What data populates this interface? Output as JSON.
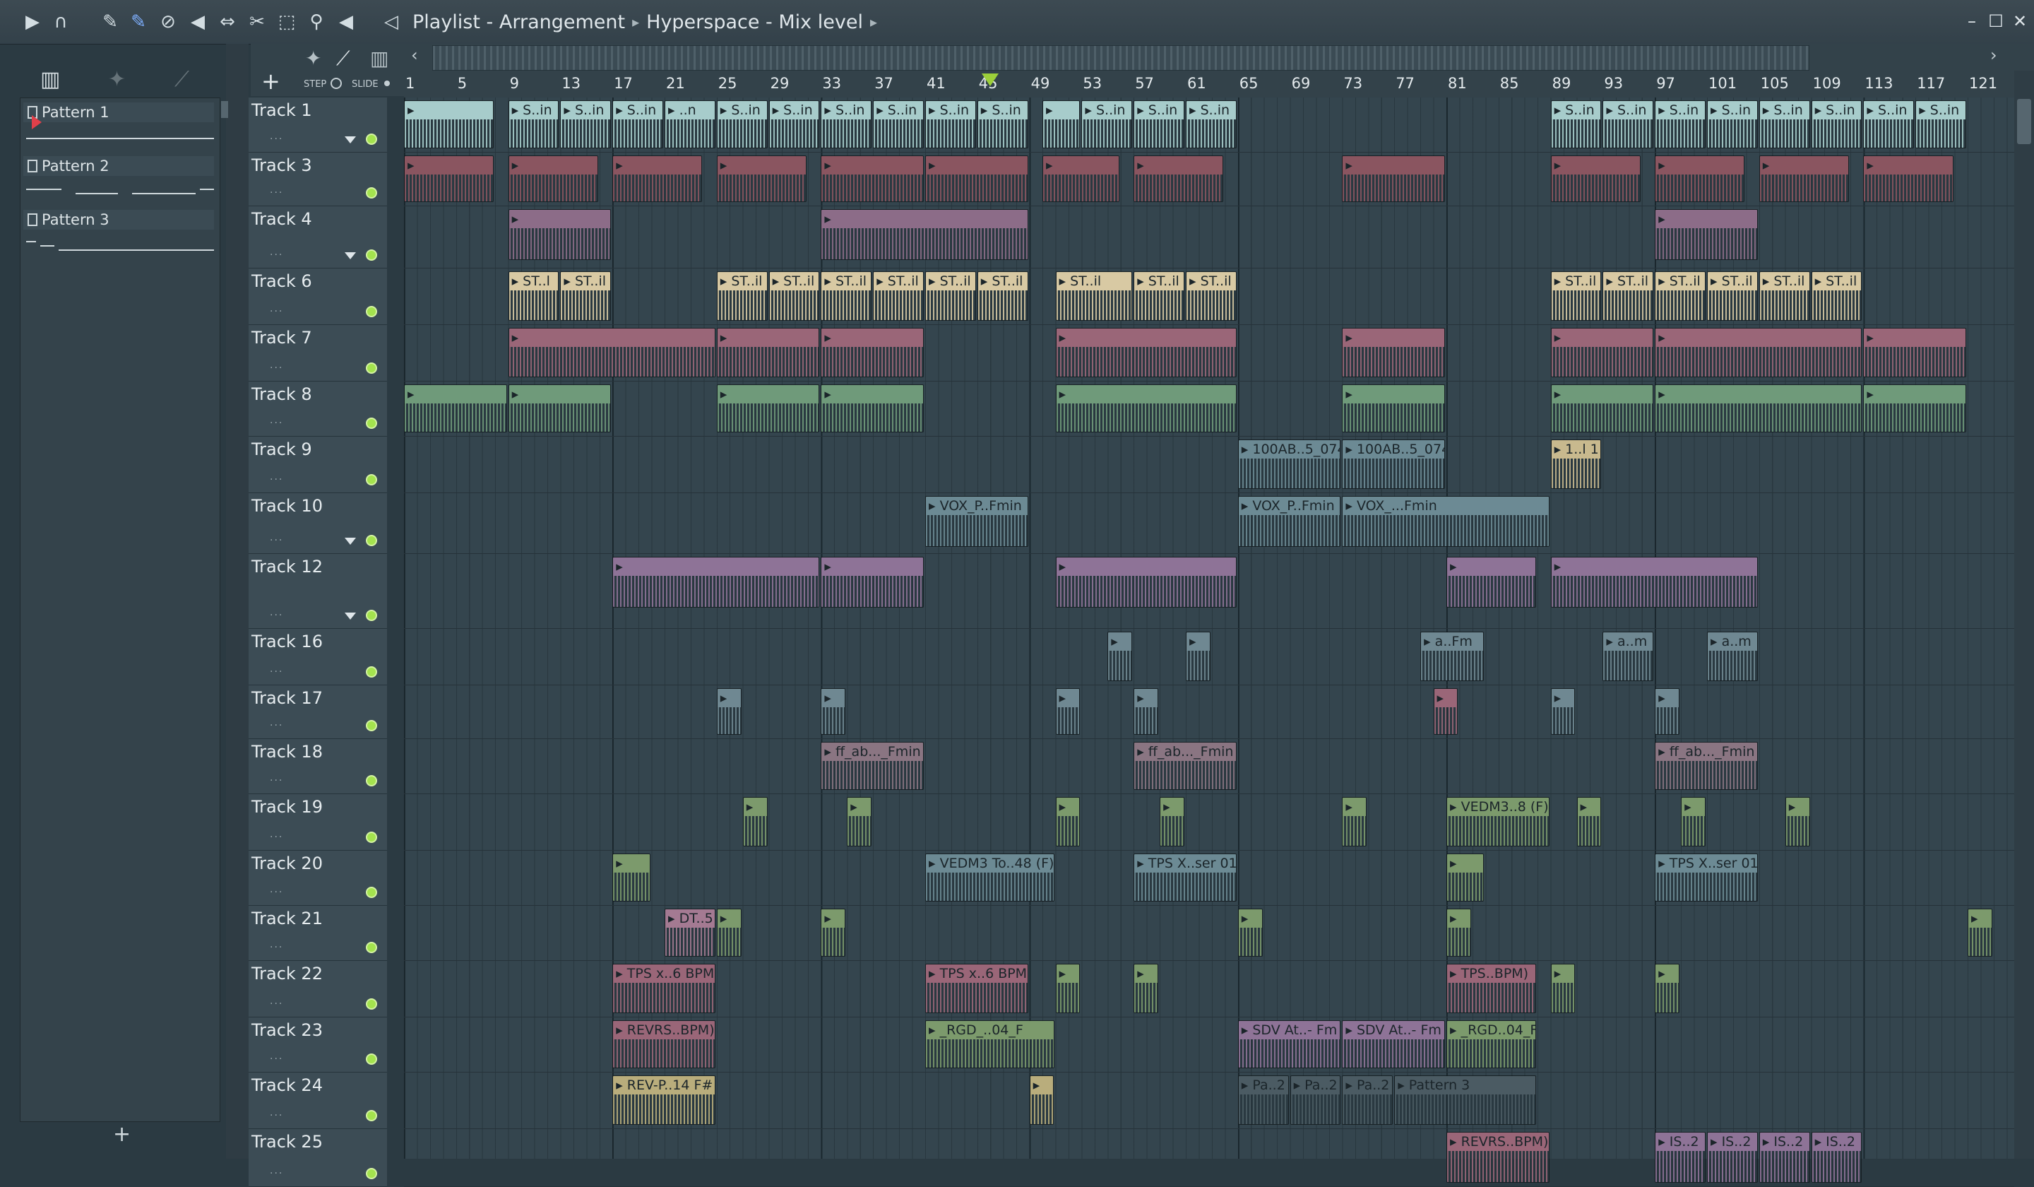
{
  "window": {
    "title": "Playlist - Arrangement",
    "breadcrumb_sep": "▸",
    "arrangement": "Hyperspace - Mix level",
    "controls": [
      "minimize",
      "maximize",
      "close"
    ]
  },
  "toolbar": {
    "icons": [
      "play-icon",
      "magnet-icon",
      "pencil-icon",
      "paint-brush-icon",
      "delete-icon",
      "mute-icon",
      "slip-icon",
      "slice-icon",
      "select-icon",
      "zoom-icon",
      "playback-icon",
      "speaker-icon"
    ]
  },
  "controls_row": {
    "add_track_symbol": "+",
    "step_label": "STEP",
    "slide_label": "SLIDE",
    "left_arrow": "‹",
    "right_arrow": "›"
  },
  "picker": {
    "add_symbol": "+",
    "patterns": [
      {
        "name": "Pattern 1"
      },
      {
        "name": "Pattern 2"
      },
      {
        "name": "Pattern 3"
      }
    ]
  },
  "ruler": {
    "bars": [
      "1",
      "5",
      "9",
      "13",
      "17",
      "21",
      "25",
      "29",
      "33",
      "37",
      "41",
      "45",
      "49",
      "53",
      "57",
      "61",
      "65",
      "69",
      "73",
      "77",
      "81",
      "85",
      "89",
      "93",
      "97",
      "101",
      "105",
      "109",
      "113",
      "117",
      "121"
    ],
    "playhead_bar": 46
  },
  "tracks": [
    {
      "name": "Track 1",
      "arrow": true
    },
    {
      "name": "Track 3",
      "arrow": false
    },
    {
      "name": "Track 4",
      "arrow": true
    },
    {
      "name": "Track 6",
      "arrow": false
    },
    {
      "name": "Track 7",
      "arrow": false
    },
    {
      "name": "Track 8",
      "arrow": false
    },
    {
      "name": "Track 9",
      "arrow": false
    },
    {
      "name": "Track 10",
      "arrow": true
    },
    {
      "name": "Track 12",
      "arrow": true
    },
    {
      "name": "Track 16",
      "arrow": false
    },
    {
      "name": "Track 17",
      "arrow": false
    },
    {
      "name": "Track 18",
      "arrow": false
    },
    {
      "name": "Track 19",
      "arrow": false
    },
    {
      "name": "Track 20",
      "arrow": false
    },
    {
      "name": "Track 21",
      "arrow": false
    },
    {
      "name": "Track 22",
      "arrow": false
    },
    {
      "name": "Track 23",
      "arrow": false
    },
    {
      "name": "Track 24",
      "arrow": false
    },
    {
      "name": "Track 25",
      "arrow": false
    }
  ],
  "clips": [
    {
      "track": 0,
      "start": 1,
      "len": 7,
      "label": "",
      "color": "#a7cccb"
    },
    {
      "track": 0,
      "start": 9,
      "len": 4,
      "label": "S..in",
      "color": "#a7cccb"
    },
    {
      "track": 0,
      "start": 13,
      "len": 4,
      "label": "S..in",
      "color": "#a7cccb"
    },
    {
      "track": 0,
      "start": 17,
      "len": 4,
      "label": "S..in",
      "color": "#a7cccb"
    },
    {
      "track": 0,
      "start": 21,
      "len": 4,
      "label": "..n",
      "color": "#a7cccb"
    },
    {
      "track": 0,
      "start": 25,
      "len": 4,
      "label": "S..in",
      "color": "#a7cccb"
    },
    {
      "track": 0,
      "start": 29,
      "len": 4,
      "label": "S..in",
      "color": "#a7cccb"
    },
    {
      "track": 0,
      "start": 33,
      "len": 4,
      "label": "S..in",
      "color": "#a7cccb"
    },
    {
      "track": 0,
      "start": 37,
      "len": 4,
      "label": "S..in",
      "color": "#a7cccb"
    },
    {
      "track": 0,
      "start": 41,
      "len": 4,
      "label": "S..in",
      "color": "#a7cccb"
    },
    {
      "track": 0,
      "start": 45,
      "len": 4,
      "label": "S..in",
      "color": "#a7cccb"
    },
    {
      "track": 0,
      "start": 50,
      "len": 3,
      "label": "",
      "color": "#a7cccb"
    },
    {
      "track": 0,
      "start": 53,
      "len": 4,
      "label": "S..in",
      "color": "#a7cccb"
    },
    {
      "track": 0,
      "start": 57,
      "len": 4,
      "label": "S..in",
      "color": "#a7cccb"
    },
    {
      "track": 0,
      "start": 61,
      "len": 4,
      "label": "S..in",
      "color": "#a7cccb"
    },
    {
      "track": 0,
      "start": 89,
      "len": 4,
      "label": "S..in",
      "color": "#a7cccb"
    },
    {
      "track": 0,
      "start": 93,
      "len": 4,
      "label": "S..in",
      "color": "#a7cccb"
    },
    {
      "track": 0,
      "start": 97,
      "len": 4,
      "label": "S..in",
      "color": "#a7cccb"
    },
    {
      "track": 0,
      "start": 101,
      "len": 4,
      "label": "S..in",
      "color": "#a7cccb"
    },
    {
      "track": 0,
      "start": 105,
      "len": 4,
      "label": "S..in",
      "color": "#a7cccb"
    },
    {
      "track": 0,
      "start": 109,
      "len": 4,
      "label": "S..in",
      "color": "#a7cccb"
    },
    {
      "track": 0,
      "start": 113,
      "len": 4,
      "label": "S..in",
      "color": "#a7cccb"
    },
    {
      "track": 0,
      "start": 117,
      "len": 4,
      "label": "S..in",
      "color": "#a7cccb"
    },
    {
      "track": 1,
      "start": 1,
      "len": 7,
      "label": "",
      "color": "#8a5560"
    },
    {
      "track": 1,
      "start": 9,
      "len": 7,
      "label": "",
      "color": "#8a5560"
    },
    {
      "track": 1,
      "start": 17,
      "len": 7,
      "label": "",
      "color": "#8a5560"
    },
    {
      "track": 1,
      "start": 25,
      "len": 7,
      "label": "",
      "color": "#8a5560"
    },
    {
      "track": 1,
      "start": 33,
      "len": 8,
      "label": "",
      "color": "#8a5560"
    },
    {
      "track": 1,
      "start": 41,
      "len": 8,
      "label": "",
      "color": "#8a5560"
    },
    {
      "track": 1,
      "start": 50,
      "len": 6,
      "label": "",
      "color": "#8a5560"
    },
    {
      "track": 1,
      "start": 57,
      "len": 7,
      "label": "",
      "color": "#8a5560"
    },
    {
      "track": 1,
      "start": 73,
      "len": 8,
      "label": "",
      "color": "#8a5560"
    },
    {
      "track": 1,
      "start": 89,
      "len": 7,
      "label": "",
      "color": "#8a5560"
    },
    {
      "track": 1,
      "start": 97,
      "len": 7,
      "label": "",
      "color": "#8a5560"
    },
    {
      "track": 1,
      "start": 105,
      "len": 7,
      "label": "",
      "color": "#8a5560"
    },
    {
      "track": 1,
      "start": 113,
      "len": 7,
      "label": "",
      "color": "#8a5560"
    },
    {
      "track": 2,
      "start": 9,
      "len": 8,
      "label": "",
      "color": "#8c6c88"
    },
    {
      "track": 2,
      "start": 33,
      "len": 16,
      "label": "",
      "color": "#8c6c88"
    },
    {
      "track": 2,
      "start": 97,
      "len": 8,
      "label": "",
      "color": "#8c6c88"
    },
    {
      "track": 3,
      "start": 9,
      "len": 4,
      "label": "ST..l",
      "color": "#d8c9a3"
    },
    {
      "track": 3,
      "start": 13,
      "len": 4,
      "label": "ST..il",
      "color": "#d8c9a3"
    },
    {
      "track": 3,
      "start": 25,
      "len": 4,
      "label": "ST..il",
      "color": "#d8c9a3"
    },
    {
      "track": 3,
      "start": 29,
      "len": 4,
      "label": "ST..il",
      "color": "#d8c9a3"
    },
    {
      "track": 3,
      "start": 33,
      "len": 4,
      "label": "ST..il",
      "color": "#d8c9a3"
    },
    {
      "track": 3,
      "start": 37,
      "len": 4,
      "label": "ST..il",
      "color": "#d8c9a3"
    },
    {
      "track": 3,
      "start": 41,
      "len": 4,
      "label": "ST..il",
      "color": "#d8c9a3"
    },
    {
      "track": 3,
      "start": 45,
      "len": 4,
      "label": "ST..il",
      "color": "#d8c9a3"
    },
    {
      "track": 3,
      "start": 51,
      "len": 6,
      "label": "ST..il",
      "color": "#d8c9a3"
    },
    {
      "track": 3,
      "start": 57,
      "len": 4,
      "label": "ST..il",
      "color": "#d8c9a3"
    },
    {
      "track": 3,
      "start": 61,
      "len": 4,
      "label": "ST..il",
      "color": "#d8c9a3"
    },
    {
      "track": 3,
      "start": 89,
      "len": 4,
      "label": "ST..il",
      "color": "#d8c9a3"
    },
    {
      "track": 3,
      "start": 93,
      "len": 4,
      "label": "ST..il",
      "color": "#d8c9a3"
    },
    {
      "track": 3,
      "start": 97,
      "len": 4,
      "label": "ST..il",
      "color": "#d8c9a3"
    },
    {
      "track": 3,
      "start": 101,
      "len": 4,
      "label": "ST..il",
      "color": "#d8c9a3"
    },
    {
      "track": 3,
      "start": 105,
      "len": 4,
      "label": "ST..il",
      "color": "#d8c9a3"
    },
    {
      "track": 3,
      "start": 109,
      "len": 4,
      "label": "ST..il",
      "color": "#d8c9a3"
    },
    {
      "track": 4,
      "start": 9,
      "len": 16,
      "label": "",
      "color": "#9a6678"
    },
    {
      "track": 4,
      "start": 25,
      "len": 8,
      "label": "",
      "color": "#9a6678"
    },
    {
      "track": 4,
      "start": 33,
      "len": 8,
      "label": "",
      "color": "#9a6678"
    },
    {
      "track": 4,
      "start": 51,
      "len": 14,
      "label": "",
      "color": "#9a6678"
    },
    {
      "track": 4,
      "start": 73,
      "len": 8,
      "label": "",
      "color": "#9a6678"
    },
    {
      "track": 4,
      "start": 89,
      "len": 8,
      "label": "",
      "color": "#9a6678"
    },
    {
      "track": 4,
      "start": 97,
      "len": 16,
      "label": "",
      "color": "#9a6678"
    },
    {
      "track": 4,
      "start": 113,
      "len": 8,
      "label": "",
      "color": "#9a6678"
    },
    {
      "track": 5,
      "start": 1,
      "len": 8,
      "label": "",
      "color": "#6f9a7a"
    },
    {
      "track": 5,
      "start": 9,
      "len": 8,
      "label": "",
      "color": "#6f9a7a"
    },
    {
      "track": 5,
      "start": 25,
      "len": 8,
      "label": "",
      "color": "#6f9a7a"
    },
    {
      "track": 5,
      "start": 33,
      "len": 8,
      "label": "",
      "color": "#6f9a7a"
    },
    {
      "track": 5,
      "start": 51,
      "len": 14,
      "label": "",
      "color": "#6f9a7a"
    },
    {
      "track": 5,
      "start": 73,
      "len": 8,
      "label": "",
      "color": "#6f9a7a"
    },
    {
      "track": 5,
      "start": 89,
      "len": 8,
      "label": "",
      "color": "#6f9a7a"
    },
    {
      "track": 5,
      "start": 97,
      "len": 16,
      "label": "",
      "color": "#6f9a7a"
    },
    {
      "track": 5,
      "start": 113,
      "len": 8,
      "label": "",
      "color": "#6f9a7a"
    },
    {
      "track": 6,
      "start": 65,
      "len": 8,
      "label": "100AB..5_074",
      "color": "#6c8a94"
    },
    {
      "track": 6,
      "start": 73,
      "len": 8,
      "label": "100AB..5_074",
      "color": "#6c8a94"
    },
    {
      "track": 6,
      "start": 89,
      "len": 4,
      "label": "1..l 1",
      "color": "#c8b98e"
    },
    {
      "track": 7,
      "start": 41,
      "len": 8,
      "label": "VOX_P..Fmin",
      "color": "#6c8a94"
    },
    {
      "track": 7,
      "start": 65,
      "len": 8,
      "label": "VOX_P..Fmin",
      "color": "#6c8a94"
    },
    {
      "track": 7,
      "start": 73,
      "len": 16,
      "label": "VOX_...Fmin",
      "color": "#6c8a94"
    },
    {
      "track": 8,
      "start": 17,
      "len": 16,
      "label": "",
      "color": "#8e7397"
    },
    {
      "track": 8,
      "start": 33,
      "len": 8,
      "label": "",
      "color": "#8e7397"
    },
    {
      "track": 8,
      "start": 51,
      "len": 14,
      "label": "",
      "color": "#8e7397"
    },
    {
      "track": 8,
      "start": 81,
      "len": 7,
      "label": "",
      "color": "#8e7397"
    },
    {
      "track": 8,
      "start": 89,
      "len": 16,
      "label": "",
      "color": "#8e7397"
    },
    {
      "track": 9,
      "start": 55,
      "len": 2,
      "label": "",
      "color": "#6f8892"
    },
    {
      "track": 9,
      "start": 61,
      "len": 2,
      "label": "",
      "color": "#6f8892"
    },
    {
      "track": 9,
      "start": 79,
      "len": 5,
      "label": "a..Fm",
      "color": "#6f8892"
    },
    {
      "track": 9,
      "start": 93,
      "len": 4,
      "label": "a..m",
      "color": "#6f8892"
    },
    {
      "track": 9,
      "start": 101,
      "len": 4,
      "label": "a..m",
      "color": "#6f8892"
    },
    {
      "track": 10,
      "start": 25,
      "len": 2,
      "label": "",
      "color": "#6f8892"
    },
    {
      "track": 10,
      "start": 33,
      "len": 2,
      "label": "",
      "color": "#6f8892"
    },
    {
      "track": 10,
      "start": 51,
      "len": 2,
      "label": "",
      "color": "#6f8892"
    },
    {
      "track": 10,
      "start": 57,
      "len": 2,
      "label": "",
      "color": "#6f8892"
    },
    {
      "track": 10,
      "start": 80,
      "len": 2,
      "label": "",
      "color": "#9a6678"
    },
    {
      "track": 10,
      "start": 89,
      "len": 2,
      "label": "",
      "color": "#6f8892"
    },
    {
      "track": 10,
      "start": 97,
      "len": 2,
      "label": "",
      "color": "#6f8892"
    },
    {
      "track": 11,
      "start": 33,
      "len": 8,
      "label": "ff_ab..._Fmin",
      "color": "#8a7582"
    },
    {
      "track": 11,
      "start": 57,
      "len": 8,
      "label": "ff_ab..._Fmin",
      "color": "#8a7582"
    },
    {
      "track": 11,
      "start": 97,
      "len": 8,
      "label": "ff_ab..._Fmin",
      "color": "#8a7582"
    },
    {
      "track": 12,
      "start": 27,
      "len": 2,
      "label": "",
      "color": "#7c9a6c"
    },
    {
      "track": 12,
      "start": 35,
      "len": 2,
      "label": "",
      "color": "#7c9a6c"
    },
    {
      "track": 12,
      "start": 51,
      "len": 2,
      "label": "",
      "color": "#7c9a6c"
    },
    {
      "track": 12,
      "start": 59,
      "len": 2,
      "label": "",
      "color": "#7c9a6c"
    },
    {
      "track": 12,
      "start": 73,
      "len": 2,
      "label": "",
      "color": "#7c9a6c"
    },
    {
      "track": 12,
      "start": 81,
      "len": 8,
      "label": "VEDM3..8 (F)",
      "color": "#7c9a6c"
    },
    {
      "track": 12,
      "start": 91,
      "len": 2,
      "label": "",
      "color": "#7c9a6c"
    },
    {
      "track": 12,
      "start": 99,
      "len": 2,
      "label": "",
      "color": "#7c9a6c"
    },
    {
      "track": 12,
      "start": 107,
      "len": 2,
      "label": "",
      "color": "#7c9a6c"
    },
    {
      "track": 13,
      "start": 17,
      "len": 3,
      "label": "",
      "color": "#7c9a6c"
    },
    {
      "track": 13,
      "start": 41,
      "len": 10,
      "label": "VEDM3 To..48 (F)",
      "color": "#6c8a94"
    },
    {
      "track": 13,
      "start": 57,
      "len": 8,
      "label": "TPS X..ser 01",
      "color": "#6c8a94"
    },
    {
      "track": 13,
      "start": 81,
      "len": 3,
      "label": "",
      "color": "#7c9a6c"
    },
    {
      "track": 13,
      "start": 97,
      "len": 8,
      "label": "TPS X..ser 01",
      "color": "#6c8a94"
    },
    {
      "track": 14,
      "start": 21,
      "len": 4,
      "label": "DT..5",
      "color": "#a47a92"
    },
    {
      "track": 14,
      "start": 25,
      "len": 2,
      "label": "",
      "color": "#7c9a6c"
    },
    {
      "track": 14,
      "start": 33,
      "len": 2,
      "label": "",
      "color": "#7c9a6c"
    },
    {
      "track": 14,
      "start": 65,
      "len": 2,
      "label": "",
      "color": "#7c9a6c"
    },
    {
      "track": 14,
      "start": 81,
      "len": 2,
      "label": "",
      "color": "#7c9a6c"
    },
    {
      "track": 14,
      "start": 121,
      "len": 2,
      "label": "",
      "color": "#7c9a6c"
    },
    {
      "track": 15,
      "start": 17,
      "len": 8,
      "label": "TPS x..6 BPM)",
      "color": "#9a6678"
    },
    {
      "track": 15,
      "start": 41,
      "len": 8,
      "label": "TPS x..6 BPM)",
      "color": "#9a6678"
    },
    {
      "track": 15,
      "start": 51,
      "len": 2,
      "label": "",
      "color": "#7c9a6c"
    },
    {
      "track": 15,
      "start": 57,
      "len": 2,
      "label": "",
      "color": "#7c9a6c"
    },
    {
      "track": 15,
      "start": 81,
      "len": 7,
      "label": "TPS..BPM)",
      "color": "#9a6678"
    },
    {
      "track": 15,
      "start": 89,
      "len": 2,
      "label": "",
      "color": "#7c9a6c"
    },
    {
      "track": 15,
      "start": 97,
      "len": 2,
      "label": "",
      "color": "#7c9a6c"
    },
    {
      "track": 16,
      "start": 17,
      "len": 8,
      "label": "REVRS..BPM)",
      "color": "#9a6678"
    },
    {
      "track": 16,
      "start": 41,
      "len": 10,
      "label": "_RGD_..04_F",
      "color": "#7c9a6c"
    },
    {
      "track": 16,
      "start": 65,
      "len": 8,
      "label": "SDV At..- Fm",
      "color": "#8e7397"
    },
    {
      "track": 16,
      "start": 73,
      "len": 8,
      "label": "SDV At..- Fm",
      "color": "#8e7397"
    },
    {
      "track": 16,
      "start": 81,
      "len": 7,
      "label": "_RGD..04_F",
      "color": "#7c9a6c"
    },
    {
      "track": 17,
      "start": 17,
      "len": 8,
      "label": "REV-P..14 F#",
      "color": "#b9ad7c"
    },
    {
      "track": 17,
      "start": 49,
      "len": 2,
      "label": "",
      "color": "#b9ad7c"
    },
    {
      "track": 17,
      "start": 65,
      "len": 4,
      "label": "Pa..2",
      "color": "#4b5b63"
    },
    {
      "track": 17,
      "start": 69,
      "len": 4,
      "label": "Pa..2",
      "color": "#4b5b63"
    },
    {
      "track": 17,
      "start": 73,
      "len": 4,
      "label": "Pa..2",
      "color": "#4b5b63"
    },
    {
      "track": 17,
      "start": 77,
      "len": 11,
      "label": "Pattern 3",
      "color": "#4b5b63"
    },
    {
      "track": 18,
      "start": 81,
      "len": 8,
      "label": "REVRS..BPM)",
      "color": "#9a6678"
    },
    {
      "track": 18,
      "start": 97,
      "len": 4,
      "label": "IS..2",
      "color": "#8e7397"
    },
    {
      "track": 18,
      "start": 101,
      "len": 4,
      "label": "IS..2",
      "color": "#8e7397"
    },
    {
      "track": 18,
      "start": 105,
      "len": 4,
      "label": "IS..2",
      "color": "#8e7397"
    },
    {
      "track": 18,
      "start": 109,
      "len": 4,
      "label": "IS..2",
      "color": "#8e7397"
    }
  ]
}
